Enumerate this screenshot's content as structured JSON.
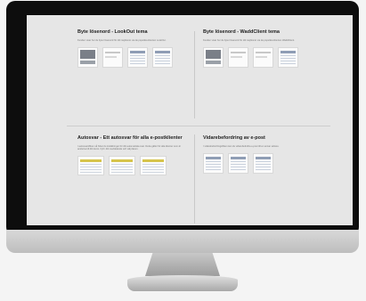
{
  "sections": [
    {
      "title": "Byte lösenord - LookOut tema",
      "description": "Kunden visar hur du byter lösenord för ditt mejlkonto via de populära klienten LookOut.",
      "thumbs": [
        "dark",
        "plain",
        "list",
        "list"
      ]
    },
    {
      "title": "Byte lösenord - WaddClient tema",
      "description": "Kunden visar hur du byter lösenord för ditt mejlkonto via de populära klienten WaddClient.",
      "thumbs": [
        "dark",
        "plain",
        "plain",
        "list"
      ]
    },
    {
      "title": "Autosvar - Ett autosvar för alla e-postklienter",
      "description": "I autosvarsfliken så hittar du inställningar för ditt automatiska svar. Detta gäller för alla klienter som är anslutna till ditt konto. Fyll i ditt meddelande och välj datum.",
      "thumbs": [
        "wide",
        "wide",
        "wide"
      ]
    },
    {
      "title": "Vidarebefordring av e-post",
      "description": "I vidarebefordringsfliken kan du vidarebefordra e-post till en annan adress.",
      "thumbs": [
        "list",
        "list",
        "list"
      ]
    }
  ]
}
